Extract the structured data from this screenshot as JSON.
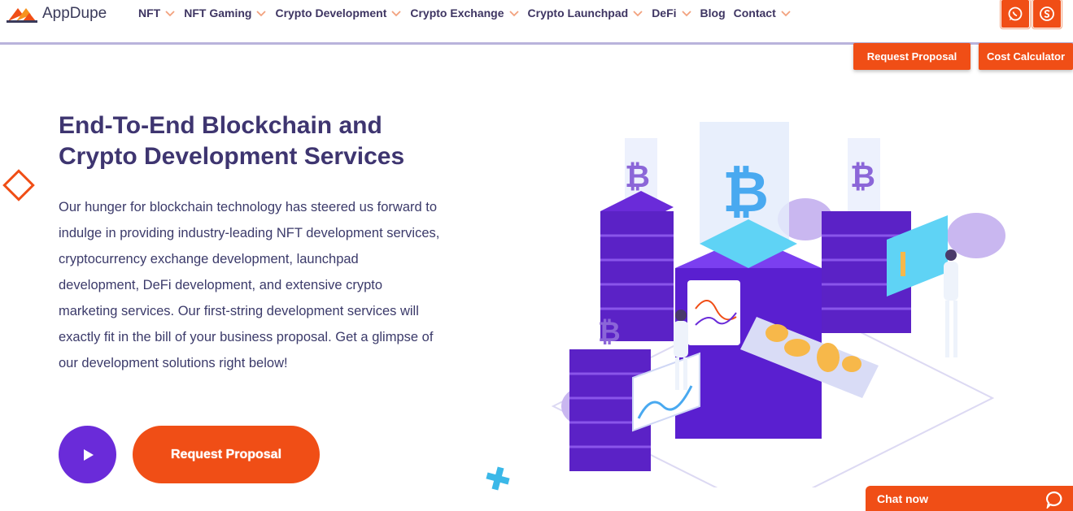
{
  "header": {
    "logo_text": "AppDupe",
    "nav": [
      {
        "label": "NFT",
        "has_dropdown": true
      },
      {
        "label": "NFT Gaming",
        "has_dropdown": true
      },
      {
        "label": "Crypto Development",
        "has_dropdown": true
      },
      {
        "label": "Crypto Exchange",
        "has_dropdown": true
      },
      {
        "label": "Crypto Launchpad",
        "has_dropdown": true
      },
      {
        "label": "DeFi",
        "has_dropdown": true
      },
      {
        "label": "Blog",
        "has_dropdown": false
      },
      {
        "label": "Contact",
        "has_dropdown": true
      }
    ],
    "social_icons": [
      "whatsapp-icon",
      "skype-icon"
    ]
  },
  "top_buttons": {
    "request_proposal": "Request Proposal",
    "cost_calculator": "Cost Calculator"
  },
  "hero": {
    "title": "End-To-End Blockchain and Crypto Development Services",
    "title_line1": "End-To-End Blockchain and",
    "title_line2": "Crypto Development Services",
    "body": "Our hunger for blockchain technology has steered us forward to indulge in providing industry-leading NFT development services, cryptocurrency exchange development, launchpad development, DeFi development, and extensive crypto marketing services. Our first-string development services will exactly fit in the bill of your business proposal. Get a glimpse of our development solutions right below!",
    "cta_label": "Request Proposal"
  },
  "chat": {
    "label": "Chat now"
  },
  "colors": {
    "accent": "#f04e16",
    "purple": "#6a2bd9",
    "title": "#3e3570",
    "nav_text": "#3e3562"
  }
}
